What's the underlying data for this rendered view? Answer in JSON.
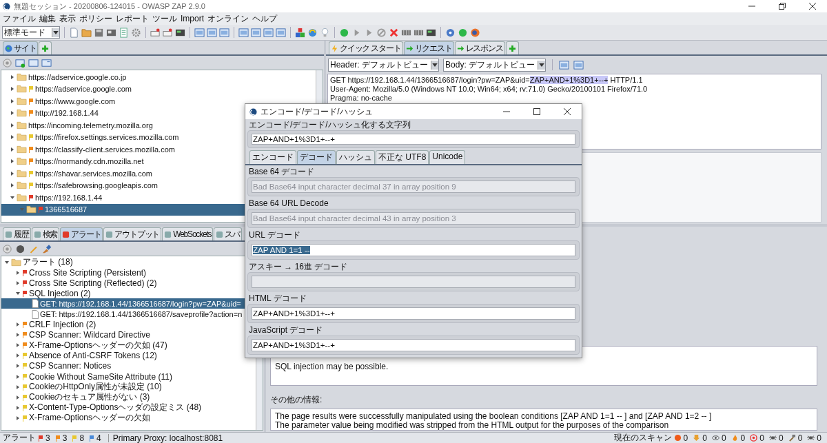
{
  "window": {
    "title": "無題セッション - 20200806-124015 - OWASP ZAP 2.9.0"
  },
  "menu": [
    "ファイル",
    "編集",
    "表示",
    "ポリシー",
    "レポート",
    "ツール",
    "Import",
    "オンライン",
    "ヘルプ"
  ],
  "mode_select": {
    "value": "標準モード"
  },
  "sites_tabs": [
    {
      "label": "サイト",
      "selected": true
    }
  ],
  "sites_tree": [
    {
      "label": "https://adservice.google.co.jp",
      "expanded": false,
      "selected": false
    },
    {
      "label": "https://adservice.google.com",
      "expanded": false,
      "selected": false,
      "color": "#e8c830"
    },
    {
      "label": "https://www.google.com",
      "expanded": false,
      "selected": false,
      "color": "#f08c1c"
    },
    {
      "label": "http://192.168.1.44",
      "expanded": false,
      "selected": false,
      "color": "#f08c1c"
    },
    {
      "label": "https://incoming.telemetry.mozilla.org",
      "expanded": false,
      "selected": false
    },
    {
      "label": "https://firefox.settings.services.mozilla.com",
      "expanded": false,
      "selected": false,
      "color": "#e8c830"
    },
    {
      "label": "https://classify-client.services.mozilla.com",
      "expanded": false,
      "selected": false,
      "color": "#f08c1c"
    },
    {
      "label": "https://normandy.cdn.mozilla.net",
      "expanded": false,
      "selected": false,
      "color": "#f08c1c"
    },
    {
      "label": "https://shavar.services.mozilla.com",
      "expanded": false,
      "selected": false,
      "color": "#e8c830"
    },
    {
      "label": "https://safebrowsing.googleapis.com",
      "expanded": false,
      "selected": false,
      "color": "#e8c830"
    },
    {
      "label": "https://192.168.1.44",
      "expanded": true,
      "selected": false,
      "color": "#e03a2a",
      "children": [
        {
          "label": "1366516687",
          "expanded": true,
          "selected": true,
          "color": "#e03a2a"
        }
      ]
    }
  ],
  "request_tabs": [
    {
      "label": "クイック スタート",
      "selected": false
    },
    {
      "label": "リクエスト",
      "selected": true
    },
    {
      "label": "レスポンス",
      "selected": false
    }
  ],
  "view_selects": [
    {
      "value": "Header: デフォルトビュー"
    },
    {
      "value": "Body: デフォルトビュー"
    }
  ],
  "request_lines": [
    [
      {
        "text": "GET https://192.168.1.44/1366516687/login?pw=ZAP&uid=",
        "highlighted": false
      },
      {
        "text": "ZAP+AND+1%3D1+--+",
        "highlighted": true
      },
      {
        "text": " HTTP/1.1",
        "highlighted": false
      }
    ],
    [
      {
        "text": "User-Agent: Mozilla/5.0 (Windows NT 10.0; Win64; x64; rv:71.0) Gecko/20100101 Firefox/71.0",
        "highlighted": false
      }
    ],
    [
      {
        "text": "Pragma: no-cache",
        "highlighted": false
      }
    ]
  ],
  "bottom_tabs": [
    {
      "label": "履歴",
      "selected": false
    },
    {
      "label": "検索",
      "selected": false
    },
    {
      "label": "アラート",
      "selected": true
    },
    {
      "label": "アウトプット",
      "selected": false
    },
    {
      "label": "WebSockets",
      "selected": false
    },
    {
      "label": "スパ",
      "selected": false
    }
  ],
  "alerts_tree": [
    {
      "label": "アラート (18)",
      "expanded": true,
      "selected": false,
      "children": [
        {
          "label": "Cross Site Scripting (Persistent)",
          "expanded": false,
          "selected": false,
          "color": "#e03a2a"
        },
        {
          "label": "Cross Site Scripting (Reflected) (2)",
          "expanded": false,
          "selected": false,
          "color": "#e03a2a"
        },
        {
          "label": "SQL Injection (2)",
          "expanded": true,
          "selected": false,
          "color": "#e03a2a",
          "children": [
            {
              "label": "GET: https://192.168.1.44/1366516687/login?pw=ZAP&uid=",
              "selected": true
            },
            {
              "label": "GET: https://192.168.1.44/1366516687/saveprofile?action=n",
              "selected": false
            }
          ]
        },
        {
          "label": "CRLF Injection (2)",
          "expanded": false,
          "selected": false,
          "color": "#f08c1c"
        },
        {
          "label": "CSP Scanner: Wildcard Directive",
          "expanded": false,
          "selected": false,
          "color": "#f08c1c"
        },
        {
          "label": "X-Frame-Optionsヘッダーの欠如 (47)",
          "expanded": false,
          "selected": false,
          "color": "#f08c1c"
        },
        {
          "label": "Absence of Anti-CSRF Tokens (12)",
          "expanded": false,
          "selected": false,
          "color": "#e8c830"
        },
        {
          "label": "CSP Scanner: Notices",
          "expanded": false,
          "selected": false,
          "color": "#e8c830"
        },
        {
          "label": "Cookie Without SameSite Attribute (11)",
          "expanded": false,
          "selected": false,
          "color": "#e8c830"
        },
        {
          "label": "CookieのHttpOnly属性が未設定 (10)",
          "expanded": false,
          "selected": false,
          "color": "#e8c830"
        },
        {
          "label": "Cookieのセキュア属性がない (3)",
          "expanded": false,
          "selected": false,
          "color": "#e8c830"
        },
        {
          "label": "X-Content-Type-Optionsヘッダの設定ミス (48)",
          "expanded": false,
          "selected": false,
          "color": "#e8c830"
        },
        {
          "label": "X-Frame-Optionsヘッダーの欠如",
          "expanded": false,
          "selected": false,
          "color": "#e8c830"
        }
      ]
    }
  ],
  "details": {
    "description": "SQL injection may be possible.",
    "other_info_label": "その他の情報:",
    "other_info": [
      "The page results were successfully manipulated using the boolean conditions [ZAP AND 1=1 -- ] and [ZAP AND 1=2 -- ]",
      "The parameter value being modified was stripped from the HTML output for the purposes of the comparison"
    ]
  },
  "dialog": {
    "title": "エンコード/デコード/ハッシュ",
    "input_label": "エンコード/デコード/ハッシュ化する文字列",
    "input_value": "ZAP+AND+1%3D1+--+",
    "tabs": [
      {
        "label": "エンコード",
        "selected": false
      },
      {
        "label": "デコード",
        "selected": true
      },
      {
        "label": "ハッシュ",
        "selected": false
      },
      {
        "label": "不正な UTF8",
        "selected": false
      },
      {
        "label": "Unicode",
        "selected": false
      }
    ],
    "fields": [
      {
        "label": "Base 64 デコード",
        "value": "Bad Base64 input character decimal 37 in array position 9",
        "disabled": true,
        "selected": false
      },
      {
        "label": "Base 64 URL Decode",
        "value": "Bad Base64 input character decimal 43 in array position 3",
        "disabled": true,
        "selected": false
      },
      {
        "label": "URL デコード",
        "value": "ZAP AND 1=1 --",
        "disabled": false,
        "selected": true
      },
      {
        "label": "アスキー → 16進 デコード",
        "disabled": true
      },
      {
        "label": "HTML デコード",
        "value": "ZAP+AND+1%3D1+--+",
        "disabled": false,
        "selected": false
      },
      {
        "label": "JavaScript デコード",
        "value": "ZAP+AND+1%3D1+--+",
        "disabled": false,
        "selected": false
      }
    ]
  },
  "status_bar": {
    "alerts_label": "アラート",
    "alert_counts": [
      {
        "count": "3",
        "color": "#e03a2a"
      },
      {
        "count": "3",
        "color": "#f08c1c"
      },
      {
        "count": "8",
        "color": "#e8c830"
      },
      {
        "count": "4",
        "color": "#4a8ad8"
      }
    ],
    "proxy": "Primary Proxy: localhost:8081",
    "scan_label": "現在のスキャン",
    "scan_counts": [
      "0",
      "0",
      "0",
      "0",
      "0",
      "0",
      "0",
      "0"
    ]
  }
}
